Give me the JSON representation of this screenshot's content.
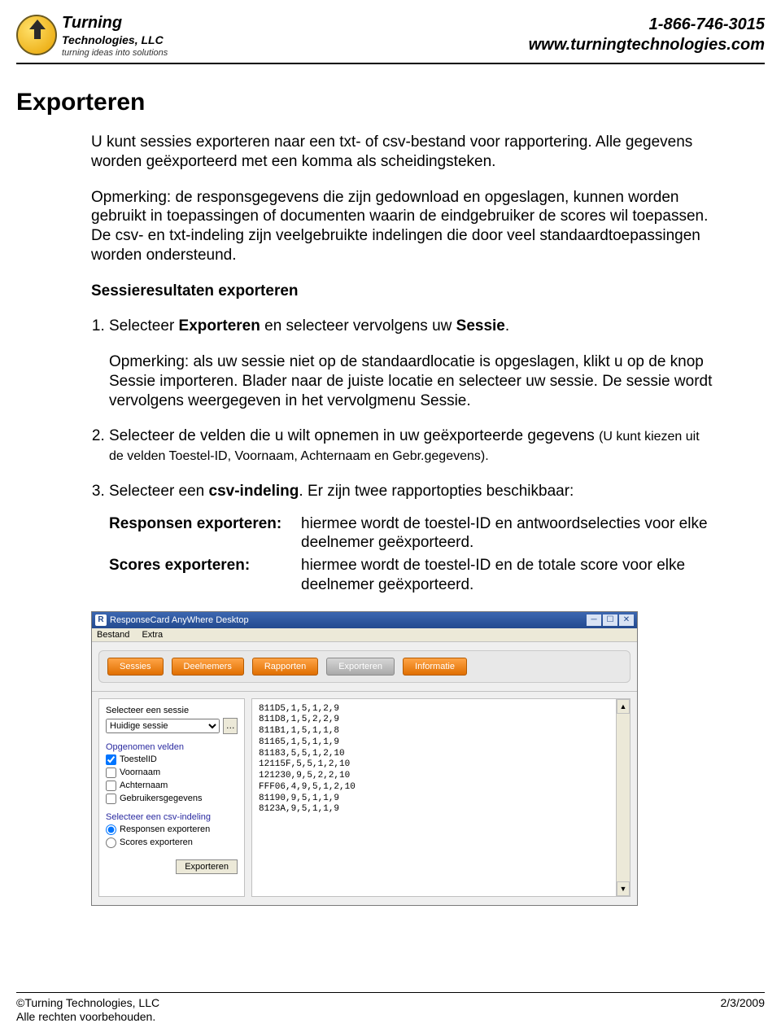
{
  "header": {
    "brand_line1": "Turning",
    "brand_line2": "Technologies, LLC",
    "brand_tagline": "turning ideas into solutions",
    "phone": "1-866-746-3015",
    "url": "www.turningtechnologies.com"
  },
  "title": "Exporteren",
  "intro_p1": "U kunt sessies exporteren naar een txt- of csv-bestand voor rapportering. Alle gegevens worden geëxporteerd met een komma als scheidingsteken.",
  "intro_p2": "Opmerking: de responsgegevens die zijn gedownload en opgeslagen, kunnen worden gebruikt in toepassingen of documenten waarin de eindgebruiker de scores wil toepassen. De csv- en txt-indeling zijn veelgebruikte indelingen die door veel standaardtoepassingen worden ondersteund.",
  "subheading": "Sessieresultaten exporteren",
  "steps": {
    "s1_prefix": "Selecteer ",
    "s1_b1": "Exporteren",
    "s1_mid": " en selecteer vervolgens uw ",
    "s1_b2": "Sessie",
    "s1_suffix": ".",
    "s1_note": "Opmerking: als uw sessie niet op de standaardlocatie is opgeslagen, klikt u op de knop Sessie importeren. Blader naar de juiste locatie en selecteer uw sessie. De sessie wordt vervolgens weergegeven in het vervolgmenu Sessie.",
    "s2_main": "Selecteer de velden die u wilt opnemen in uw geëxporteerde gegevens ",
    "s2_small": "(U kunt kiezen uit de velden Toestel-ID, Voornaam, Achternaam en Gebr.gegevens).",
    "s3_prefix": "Selecteer een ",
    "s3_b": "csv-indeling",
    "s3_suffix": ". Er zijn twee rapportopties beschikbaar:"
  },
  "defs": {
    "label1": "Responsen exporteren:",
    "text1": "hiermee wordt de toestel-ID en antwoordselecties voor elke deelnemer geëxporteerd.",
    "label2": "Scores exporteren:",
    "text2": "hiermee wordt de toestel-ID en de totale score voor elke deelnemer geëxporteerd."
  },
  "app": {
    "window_title": "ResponseCard AnyWhere Desktop",
    "menu": {
      "m1": "Bestand",
      "m2": "Extra"
    },
    "tabs": {
      "t1": "Sessies",
      "t2": "Deelnemers",
      "t3": "Rapporten",
      "t4": "Exporteren",
      "t5": "Informatie"
    },
    "left": {
      "select_session_label": "Selecteer een sessie",
      "session_value": "Huidige sessie",
      "included_fields_label": "Opgenomen velden",
      "cb_toestelid": "ToestelID",
      "cb_voornaam": "Voornaam",
      "cb_achternaam": "Achternaam",
      "cb_gebruikers": "Gebruikersgegevens",
      "csv_label": "Selecteer een csv-indeling",
      "rb_responsen": "Responsen exporteren",
      "rb_scores": "Scores exporteren",
      "export_btn": "Exporteren"
    },
    "output_lines": [
      "811D5,1,5,1,2,9",
      "811D8,1,5,2,2,9",
      "811B1,1,5,1,1,8",
      "81165,1,5,1,1,9",
      "81183,5,5,1,2,10",
      "12115F,5,5,1,2,10",
      "121230,9,5,2,2,10",
      "FFF06,4,9,5,1,2,10",
      "81190,9,5,1,1,9",
      "8123A,9,5,1,1,9"
    ]
  },
  "footer": {
    "copyright": "©Turning Technologies, LLC",
    "rights": "Alle rechten voorbehouden.",
    "date": "2/3/2009"
  }
}
